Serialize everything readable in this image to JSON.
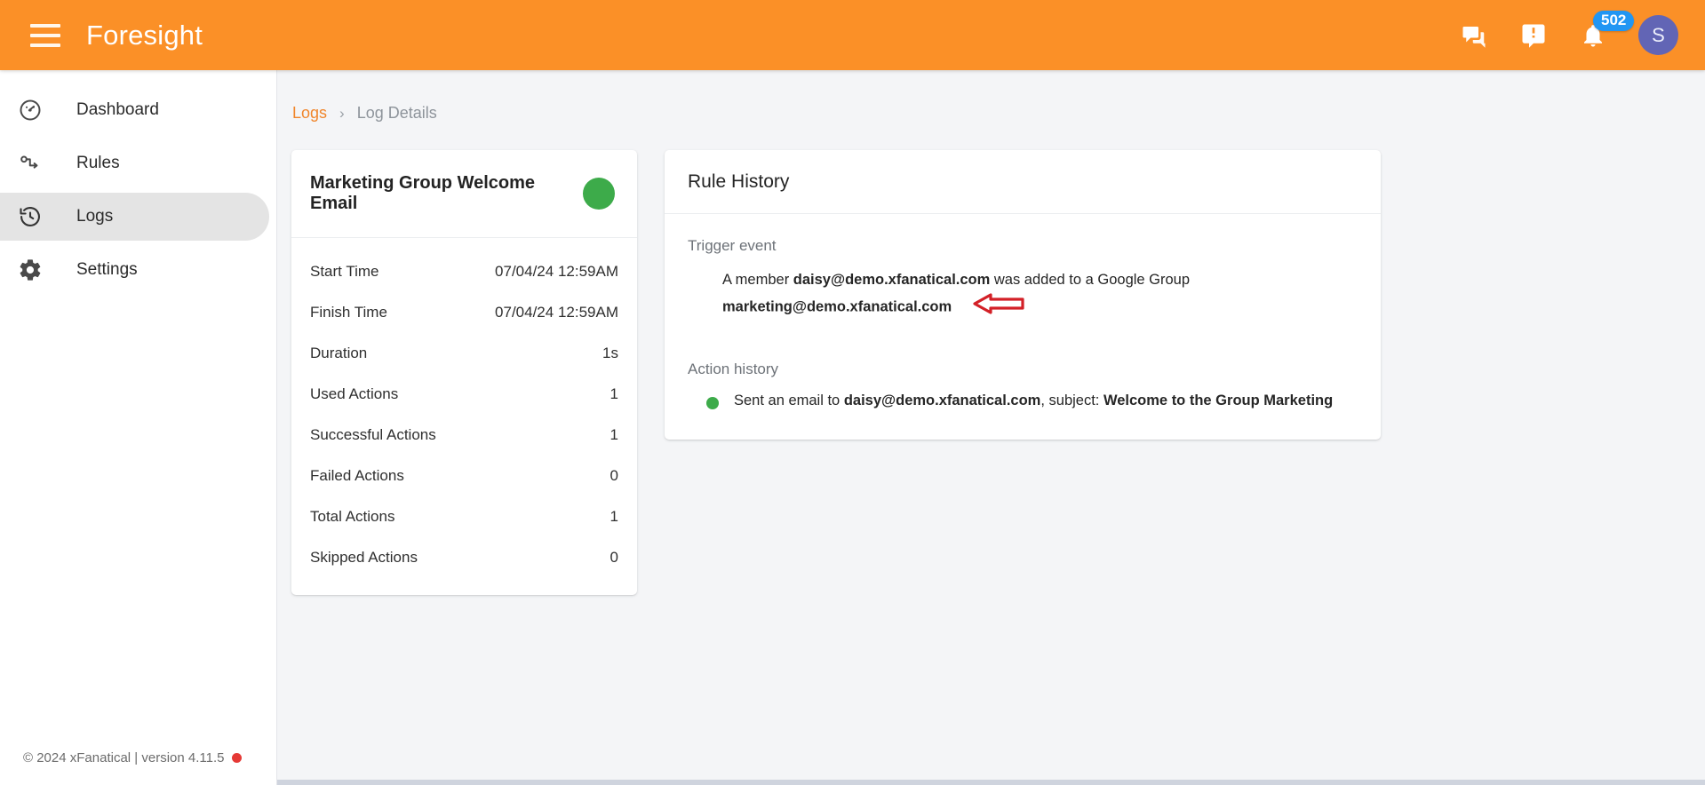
{
  "topbar": {
    "brand": "Foresight",
    "menu_icon": "hamburger-menu-icon",
    "icons": [
      {
        "name": "forum-icon",
        "label": "Forum"
      },
      {
        "name": "feedback-icon",
        "label": "Feedback"
      },
      {
        "name": "notifications-bell-icon",
        "label": "Notifications"
      }
    ],
    "notification_count": "502",
    "avatar_initial": "S",
    "bg_color": "#FB9027",
    "badge_color": "#2196f3",
    "avatar_color": "#6265b5"
  },
  "sidebar": {
    "items": [
      {
        "label": "Dashboard",
        "icon": "speedometer-icon",
        "active": false
      },
      {
        "label": "Rules",
        "icon": "rules-node-icon",
        "active": false
      },
      {
        "label": "Logs",
        "icon": "history-clock-icon",
        "active": true
      },
      {
        "label": "Settings",
        "icon": "gear-icon",
        "active": false
      }
    ],
    "footer": "© 2024 xFanatical | version 4.11.5",
    "footer_dot_color": "#e53935"
  },
  "breadcrumb": {
    "parent": "Logs",
    "separator": "›",
    "current": "Log Details"
  },
  "summary_card": {
    "title": "Marketing Group Welcome Email",
    "status_color": "#3dab4a",
    "rows": [
      {
        "label": "Start Time",
        "value": "07/04/24 12:59AM"
      },
      {
        "label": "Finish Time",
        "value": "07/04/24 12:59AM"
      },
      {
        "label": "Duration",
        "value": "1s"
      },
      {
        "label": "Used Actions",
        "value": "1"
      },
      {
        "label": "Successful Actions",
        "value": "1"
      },
      {
        "label": "Failed Actions",
        "value": "0"
      },
      {
        "label": "Total Actions",
        "value": "1"
      },
      {
        "label": "Skipped Actions",
        "value": "0"
      }
    ]
  },
  "history_card": {
    "title": "Rule History",
    "trigger_label": "Trigger event",
    "trigger_event": {
      "prefix": "A member ",
      "member_email": "daisy@demo.xfanatical.com",
      "middle": " was added to a Google Group ",
      "group_email": "marketing@demo.xfanatical.com",
      "annotation": "red-left-arrow-annotation",
      "annotation_color": "#d32027"
    },
    "action_label": "Action history",
    "action": {
      "status_color": "#3dab4a",
      "prefix": "Sent an email to ",
      "recipient": "daisy@demo.xfanatical.com",
      "middle": ", subject: ",
      "subject": "Welcome to the Group Marketing"
    }
  }
}
